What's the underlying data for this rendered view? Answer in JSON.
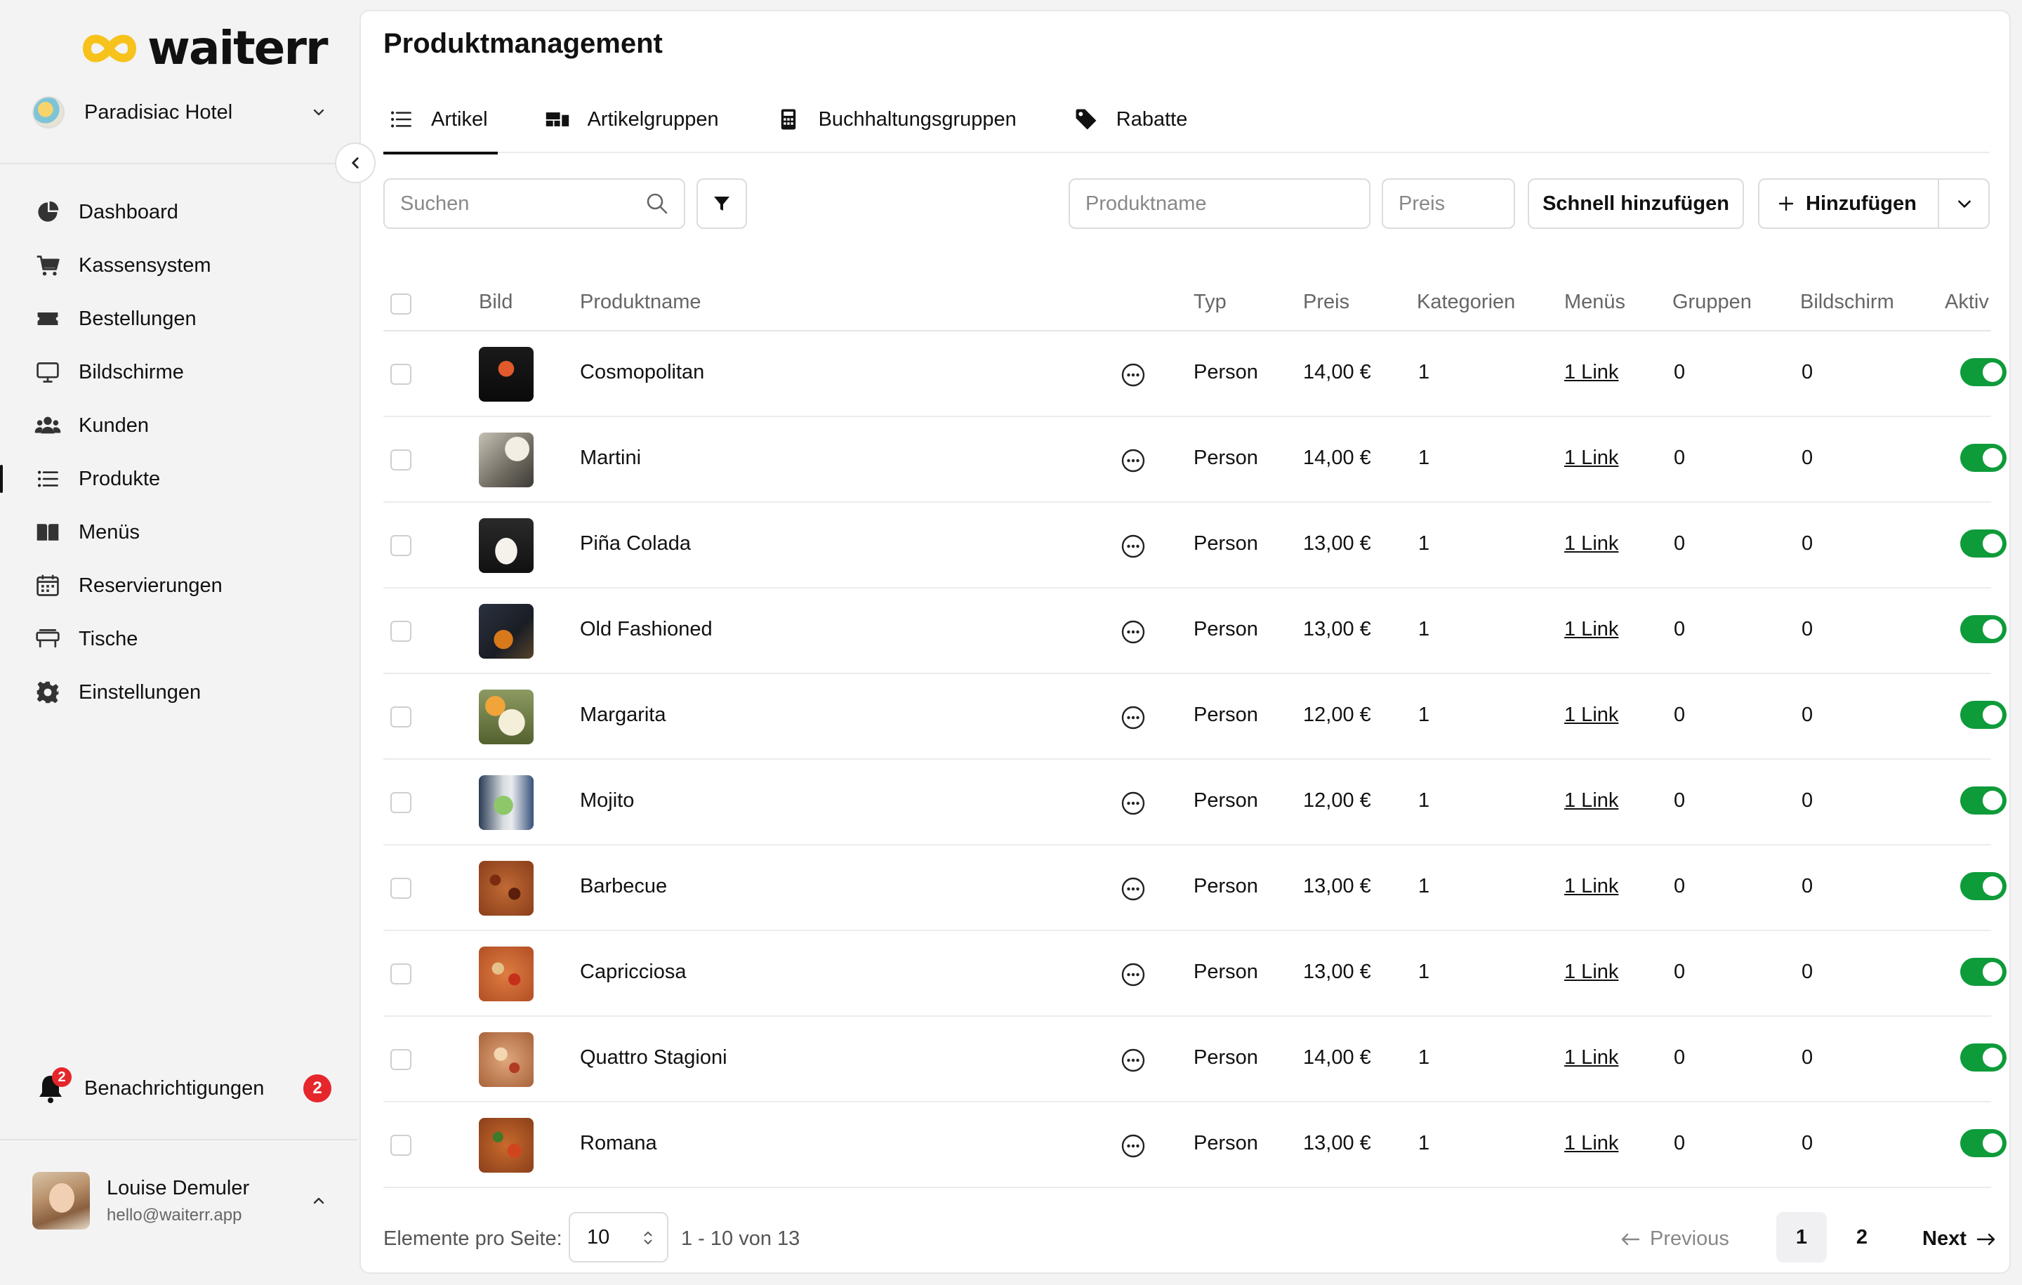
{
  "brand": {
    "name": "waiterr"
  },
  "hotel": {
    "name": "Paradisiac Hotel"
  },
  "sidebar": {
    "items": [
      {
        "label": "Dashboard",
        "icon": "pie-chart-icon"
      },
      {
        "label": "Kassensystem",
        "icon": "cart-icon"
      },
      {
        "label": "Bestellungen",
        "icon": "ticket-icon"
      },
      {
        "label": "Bildschirme",
        "icon": "monitor-icon"
      },
      {
        "label": "Kunden",
        "icon": "users-icon"
      },
      {
        "label": "Produkte",
        "icon": "list-icon",
        "active": true
      },
      {
        "label": "Menüs",
        "icon": "book-icon"
      },
      {
        "label": "Reservierungen",
        "icon": "calendar-icon"
      },
      {
        "label": "Tische",
        "icon": "table-icon"
      },
      {
        "label": "Einstellungen",
        "icon": "gear-icon"
      }
    ],
    "notifications": {
      "label": "Benachrichtigungen",
      "count": "2",
      "bell_badge": "2"
    },
    "user": {
      "name": "Louise Demuler",
      "email": "hello@waiterr.app"
    }
  },
  "page": {
    "title": "Produktmanagement"
  },
  "tabs": [
    {
      "label": "Artikel",
      "icon": "list-icon",
      "active": true
    },
    {
      "label": "Artikelgruppen",
      "icon": "groups-icon"
    },
    {
      "label": "Buchhaltungsgruppen",
      "icon": "calculator-icon"
    },
    {
      "label": "Rabatte",
      "icon": "tag-icon"
    }
  ],
  "toolbar": {
    "search_placeholder": "Suchen",
    "product_name_placeholder": "Produktname",
    "price_placeholder": "Preis",
    "quick_add_label": "Schnell hinzufügen",
    "add_label": "Hinzufügen"
  },
  "table": {
    "headers": {
      "image": "Bild",
      "name": "Produktname",
      "type": "Typ",
      "price": "Preis",
      "categories": "Kategorien",
      "menus": "Menüs",
      "groups": "Gruppen",
      "screen": "Bildschirm",
      "active": "Aktiv"
    },
    "rows": [
      {
        "name": "Cosmopolitan",
        "type": "Person",
        "price": "14,00 €",
        "categories": "1",
        "menus": "1 Link",
        "groups": "0",
        "screen": "0",
        "active": true,
        "thumb": "cocktail-red"
      },
      {
        "name": "Martini",
        "type": "Person",
        "price": "14,00 €",
        "categories": "1",
        "menus": "1 Link",
        "groups": "0",
        "screen": "0",
        "active": true,
        "thumb": "martini"
      },
      {
        "name": "Piña Colada",
        "type": "Person",
        "price": "13,00 €",
        "categories": "1",
        "menus": "1 Link",
        "groups": "0",
        "screen": "0",
        "active": true,
        "thumb": "pina-colada"
      },
      {
        "name": "Old Fashioned",
        "type": "Person",
        "price": "13,00 €",
        "categories": "1",
        "menus": "1 Link",
        "groups": "0",
        "screen": "0",
        "active": true,
        "thumb": "old-fashioned"
      },
      {
        "name": "Margarita",
        "type": "Person",
        "price": "12,00 €",
        "categories": "1",
        "menus": "1 Link",
        "groups": "0",
        "screen": "0",
        "active": true,
        "thumb": "margarita"
      },
      {
        "name": "Mojito",
        "type": "Person",
        "price": "12,00 €",
        "categories": "1",
        "menus": "1 Link",
        "groups": "0",
        "screen": "0",
        "active": true,
        "thumb": "mojito"
      },
      {
        "name": "Barbecue",
        "type": "Person",
        "price": "13,00 €",
        "categories": "1",
        "menus": "1 Link",
        "groups": "0",
        "screen": "0",
        "active": true,
        "thumb": "pizza-bbq"
      },
      {
        "name": "Capricciosa",
        "type": "Person",
        "price": "13,00 €",
        "categories": "1",
        "menus": "1 Link",
        "groups": "0",
        "screen": "0",
        "active": true,
        "thumb": "pizza-cap"
      },
      {
        "name": "Quattro Stagioni",
        "type": "Person",
        "price": "14,00 €",
        "categories": "1",
        "menus": "1 Link",
        "groups": "0",
        "screen": "0",
        "active": true,
        "thumb": "pizza-qs"
      },
      {
        "name": "Romana",
        "type": "Person",
        "price": "13,00 €",
        "categories": "1",
        "menus": "1 Link",
        "groups": "0",
        "screen": "0",
        "active": true,
        "thumb": "pizza-rom"
      }
    ]
  },
  "pagination": {
    "per_page_label": "Elemente pro Seite:",
    "per_page": "10",
    "range": "1 - 10 von 13",
    "previous": "Previous",
    "pages": [
      "1",
      "2"
    ],
    "current": "1",
    "next": "Next"
  },
  "colors": {
    "active_toggle": "#0e9b3a",
    "badge": "#e5262b",
    "logo_yellow": "#f7c21b"
  }
}
